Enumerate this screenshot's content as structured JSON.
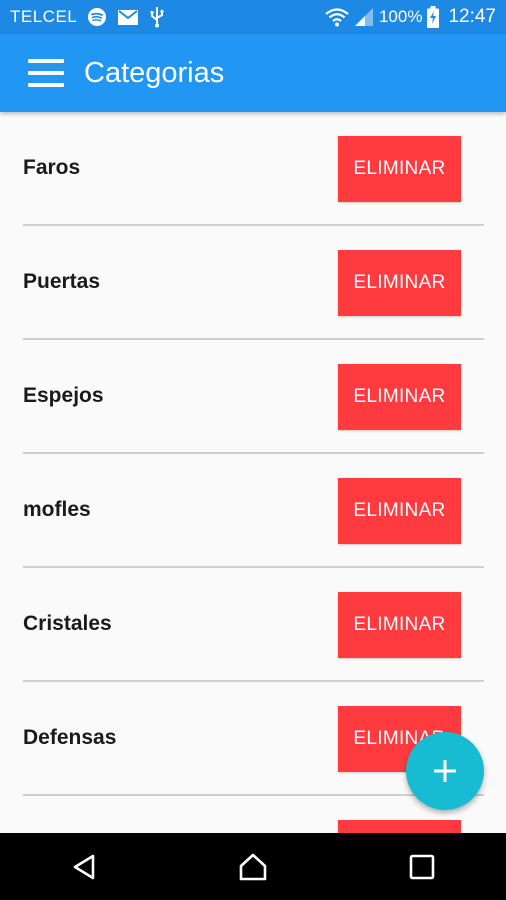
{
  "status_bar": {
    "carrier": "TELCEL",
    "battery": "100%",
    "time": "12:47",
    "icons": [
      "spotify-icon",
      "mail-icon",
      "usb-icon",
      "wifi-icon",
      "signal-icon",
      "battery-charging-icon"
    ]
  },
  "app_bar": {
    "title": "Categorias",
    "menu_icon": "hamburger-menu-icon"
  },
  "categories": [
    {
      "name": "Faros",
      "delete_label": "ELIMINAR"
    },
    {
      "name": "Puertas",
      "delete_label": "ELIMINAR"
    },
    {
      "name": "Espejos",
      "delete_label": "ELIMINAR"
    },
    {
      "name": "mofles",
      "delete_label": "ELIMINAR"
    },
    {
      "name": "Cristales",
      "delete_label": "ELIMINAR"
    },
    {
      "name": "Defensas",
      "delete_label": "ELIMINAR"
    },
    {
      "name": "",
      "delete_label": ""
    }
  ],
  "fab": {
    "icon": "plus-icon"
  },
  "nav_bar": {
    "icons": [
      "back-icon",
      "home-icon",
      "recents-icon"
    ]
  },
  "colors": {
    "status_bar": "#1e88e5",
    "app_bar": "#2196f3",
    "delete_button": "#ff3b40",
    "fab": "#17bcd3",
    "background": "#fafafa"
  }
}
